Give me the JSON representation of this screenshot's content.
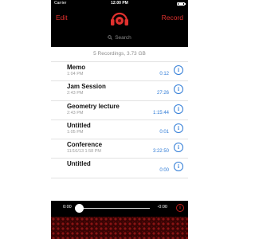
{
  "status": {
    "carrier": "Carrier",
    "time": "12:00 PM"
  },
  "nav": {
    "edit_label": "Edit",
    "record_label": "Record",
    "search_placeholder": "Search"
  },
  "summary": "5 Recordings, 3.73 GB",
  "recordings": [
    {
      "title": "Memo",
      "date": "1:04 PM",
      "duration": "0:12"
    },
    {
      "title": "Jam Session",
      "date": "2:43 PM",
      "duration": "27:26"
    },
    {
      "title": "Geometry lecture",
      "date": "2:43 PM",
      "duration": "1:15:44"
    },
    {
      "title": "Untitled",
      "date": "1:05 PM",
      "duration": "0:01"
    },
    {
      "title": "Conference",
      "date": "11/16/13 1:58 PM",
      "duration": "3:22:50"
    },
    {
      "title": "Untitled",
      "date": "",
      "duration": "0:00"
    }
  ],
  "player": {
    "current": "0:00",
    "remaining": "-0:00"
  },
  "colors": {
    "accent": "#e0312e",
    "link": "#2f7bd6",
    "background": "#000000"
  },
  "icons": {
    "logo": "headphones-record-icon",
    "search": "search-icon",
    "info": "info-icon"
  }
}
